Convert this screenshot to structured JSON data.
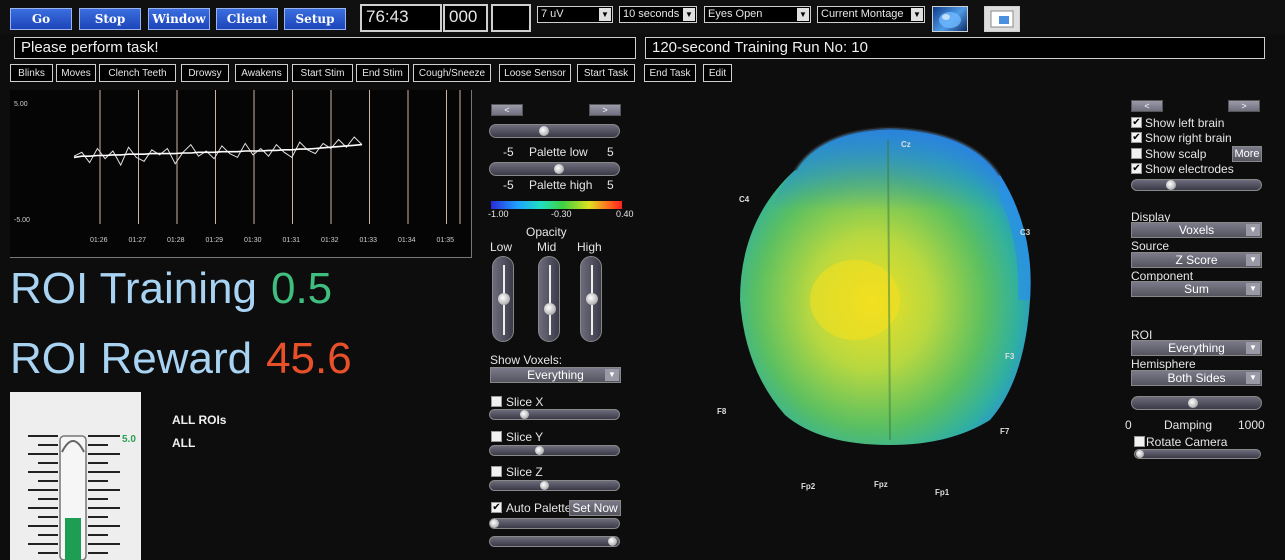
{
  "toolbar": {
    "go": "Go",
    "stop": "Stop",
    "window": "Window",
    "client": "Client",
    "setup": "Setup",
    "timer": "76:43",
    "counter": "000",
    "blank": "",
    "scale": "7 uV",
    "epoch": "10 seconds",
    "condition": "Eyes Open",
    "montage": "Current Montage"
  },
  "messages": {
    "instruction": "Please perform task!",
    "run": "120-second Training Run No: 10"
  },
  "events": [
    "Blinks",
    "Moves",
    "Clench Teeth",
    "Drowsy",
    "Awakens",
    "Start Stim",
    "End Stim",
    "Cough/Sneeze",
    "Loose Sensor",
    "Start Task",
    "End Task",
    "Edit"
  ],
  "chart_data": {
    "type": "line",
    "title": "",
    "xlabel": "",
    "ylabel": "",
    "ylim": [
      -5.0,
      5.0
    ],
    "y_ticks": [
      "5.00",
      "-5.00"
    ],
    "x_ticks": [
      "01:26",
      "01:27",
      "01:28",
      "01:29",
      "01:30",
      "01:31",
      "01:32",
      "01:33",
      "01:34",
      "01:35"
    ],
    "grid": "vertical",
    "series": [
      {
        "color": "#e0e0e0",
        "values": [
          0.3,
          0.6,
          -0.2,
          0.9,
          0.1,
          0.7,
          -0.4,
          1.0,
          0.2,
          -0.1,
          0.8,
          0.4,
          0.9,
          -0.3,
          0.6,
          1.2,
          0.3,
          0.7,
          0.1,
          1.1,
          0.5,
          0.2,
          1.3,
          0.4,
          0.9,
          0.3,
          1.2,
          0.6,
          0.2,
          1.4,
          0.8,
          0.5,
          1.3,
          0.9,
          1.6,
          1.0,
          1.8,
          1.2
        ]
      },
      {
        "color": "#ffffff",
        "values": [
          0.2,
          0.3,
          0.3,
          0.35,
          0.35,
          0.4,
          0.4,
          0.45,
          0.45,
          0.45,
          0.5,
          0.5,
          0.5,
          0.5,
          0.55,
          0.55,
          0.6,
          0.6,
          0.6,
          0.65,
          0.65,
          0.65,
          0.7,
          0.7,
          0.7,
          0.75,
          0.75,
          0.8,
          0.8,
          0.85,
          0.85,
          0.9,
          0.95,
          1.0,
          1.05,
          1.1,
          1.15,
          1.2
        ]
      }
    ]
  },
  "roi": {
    "training_label": "ROI Training",
    "training_value": "0.5",
    "reward_label": "ROI Reward",
    "reward_value": "45.6",
    "all_rois": "ALL ROIs",
    "all": "ALL",
    "thermo_level": "5.0",
    "thermo_fill": 0.35
  },
  "middle": {
    "prev": "<",
    "next": ">",
    "palette_low_min": "-5",
    "palette_low_label": "Palette low",
    "palette_low_max": "5",
    "palette_high_min": "-5",
    "palette_high_label": "Palette high",
    "palette_high_max": "5",
    "cbar_min": "-1.00",
    "cbar_mid": "-0.30",
    "cbar_max": "0.40",
    "opacity_label": "Opacity",
    "low": "Low",
    "mid": "Mid",
    "high": "High",
    "show_voxels_label": "Show Voxels:",
    "show_voxels_value": "Everything",
    "slice_x": "Slice X",
    "slice_y": "Slice Y",
    "slice_z": "Slice Z",
    "auto_palette": "Auto Palette",
    "set_now": "Set Now"
  },
  "brain": {
    "electrodes": [
      "Cz",
      "C4",
      "C3",
      "F3",
      "F8",
      "F7",
      "Fp2",
      "Fpz",
      "Fp1"
    ]
  },
  "right": {
    "prev": "<",
    "next": ">",
    "show_left": "Show left brain",
    "show_right": "Show right brain",
    "show_scalp": "Show scalp",
    "more": "More",
    "show_electrodes": "Show electrodes",
    "display_label": "Display",
    "display_value": "Voxels",
    "source_label": "Source",
    "source_value": "Z Score",
    "component_label": "Component",
    "component_value": "Sum",
    "roi_label": "ROI",
    "roi_value": "Everything",
    "hemisphere_label": "Hemisphere",
    "hemisphere_value": "Both Sides",
    "damping_min": "0",
    "damping_label": "Damping",
    "damping_max": "1000",
    "rotate_camera": "Rotate Camera"
  },
  "colors": {
    "toolbar_button": "#1c45b8",
    "roi_training_value": "#3fbf7f",
    "roi_reward_value": "#e8502a",
    "roi_label": "#a9d3f2"
  }
}
